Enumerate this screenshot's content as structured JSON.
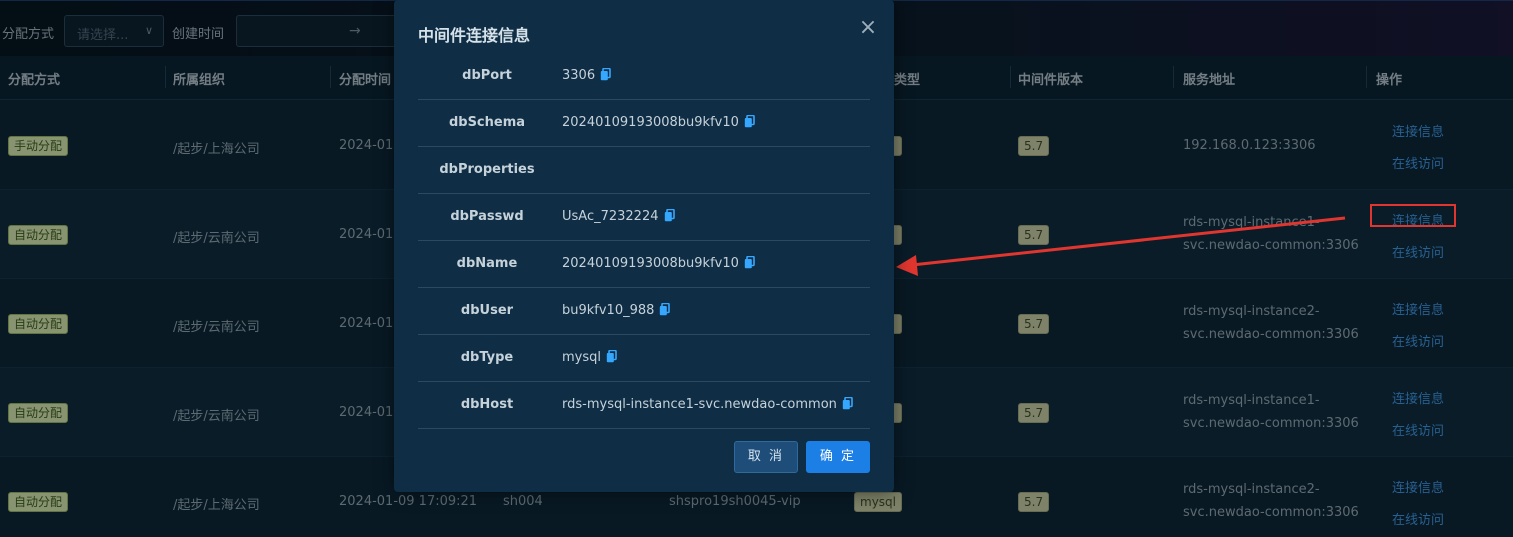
{
  "filters": {
    "assign_method_label": "分配方式",
    "assign_method_placeholder": "请选择...",
    "create_time_label": "创建时间",
    "date_range_separator": "→"
  },
  "table": {
    "headers": [
      "分配方式",
      "所属组织",
      "分配时间",
      "类型",
      "中间件版本",
      "服务地址",
      "操作"
    ],
    "rows": [
      {
        "method": "手动分配",
        "org": "/起步/上海公司",
        "time": "2024-01-",
        "type": "",
        "version": "5.7",
        "address": [
          "192.168.0.123:3306"
        ],
        "actions": [
          "连接信息",
          "在线访问"
        ]
      },
      {
        "method": "自动分配",
        "org": "/起步/云南公司",
        "time": "2024-01-",
        "type": "",
        "version": "5.7",
        "address": [
          "rds-mysql-instance1-",
          "svc.newdao-common:3306"
        ],
        "actions": [
          "连接信息",
          "在线访问"
        ]
      },
      {
        "method": "自动分配",
        "org": "/起步/云南公司",
        "time": "2024-01-",
        "type": "",
        "version": "5.7",
        "address": [
          "rds-mysql-instance2-",
          "svc.newdao-common:3306"
        ],
        "actions": [
          "连接信息",
          "在线访问"
        ]
      },
      {
        "method": "自动分配",
        "org": "/起步/云南公司",
        "time": "2024-01-",
        "type": "",
        "version": "5.7",
        "address": [
          "rds-mysql-instance1-",
          "svc.newdao-common:3306"
        ],
        "actions": [
          "连接信息",
          "在线访问"
        ]
      },
      {
        "method": "自动分配",
        "org": "/起步/上海公司",
        "time": "2024-01-09 17:09:21",
        "code": "sh004",
        "name": "shspro19sh0045-vip",
        "type": "mysql",
        "version": "5.7",
        "address": [
          "rds-mysql-instance2-",
          "svc.newdao-common:3306"
        ],
        "actions": [
          "连接信息",
          "在线访问"
        ]
      }
    ]
  },
  "modal": {
    "title": "中间件连接信息",
    "close_icon": "close-icon",
    "rows": [
      {
        "key": "dbPort",
        "value": "3306",
        "copyable": true
      },
      {
        "key": "dbSchema",
        "value": "20240109193008bu9kfv10",
        "copyable": true
      },
      {
        "key": "dbProperties",
        "value": "",
        "copyable": false
      },
      {
        "key": "dbPasswd",
        "value": "UsAc_7232224",
        "copyable": true
      },
      {
        "key": "dbName",
        "value": "20240109193008bu9kfv10",
        "copyable": true
      },
      {
        "key": "dbUser",
        "value": "bu9kfv10_988",
        "copyable": true
      },
      {
        "key": "dbType",
        "value": "mysql",
        "copyable": true
      },
      {
        "key": "dbHost",
        "value": "rds-mysql-instance1-svc.newdao-common",
        "copyable": true
      }
    ],
    "cancel_label": "取 消",
    "ok_label": "确 定"
  },
  "colors": {
    "accent": "#1c7fe6",
    "link": "#3b8ed6",
    "annotation": "#e0362f",
    "copy_icon": "#35a7ff"
  }
}
